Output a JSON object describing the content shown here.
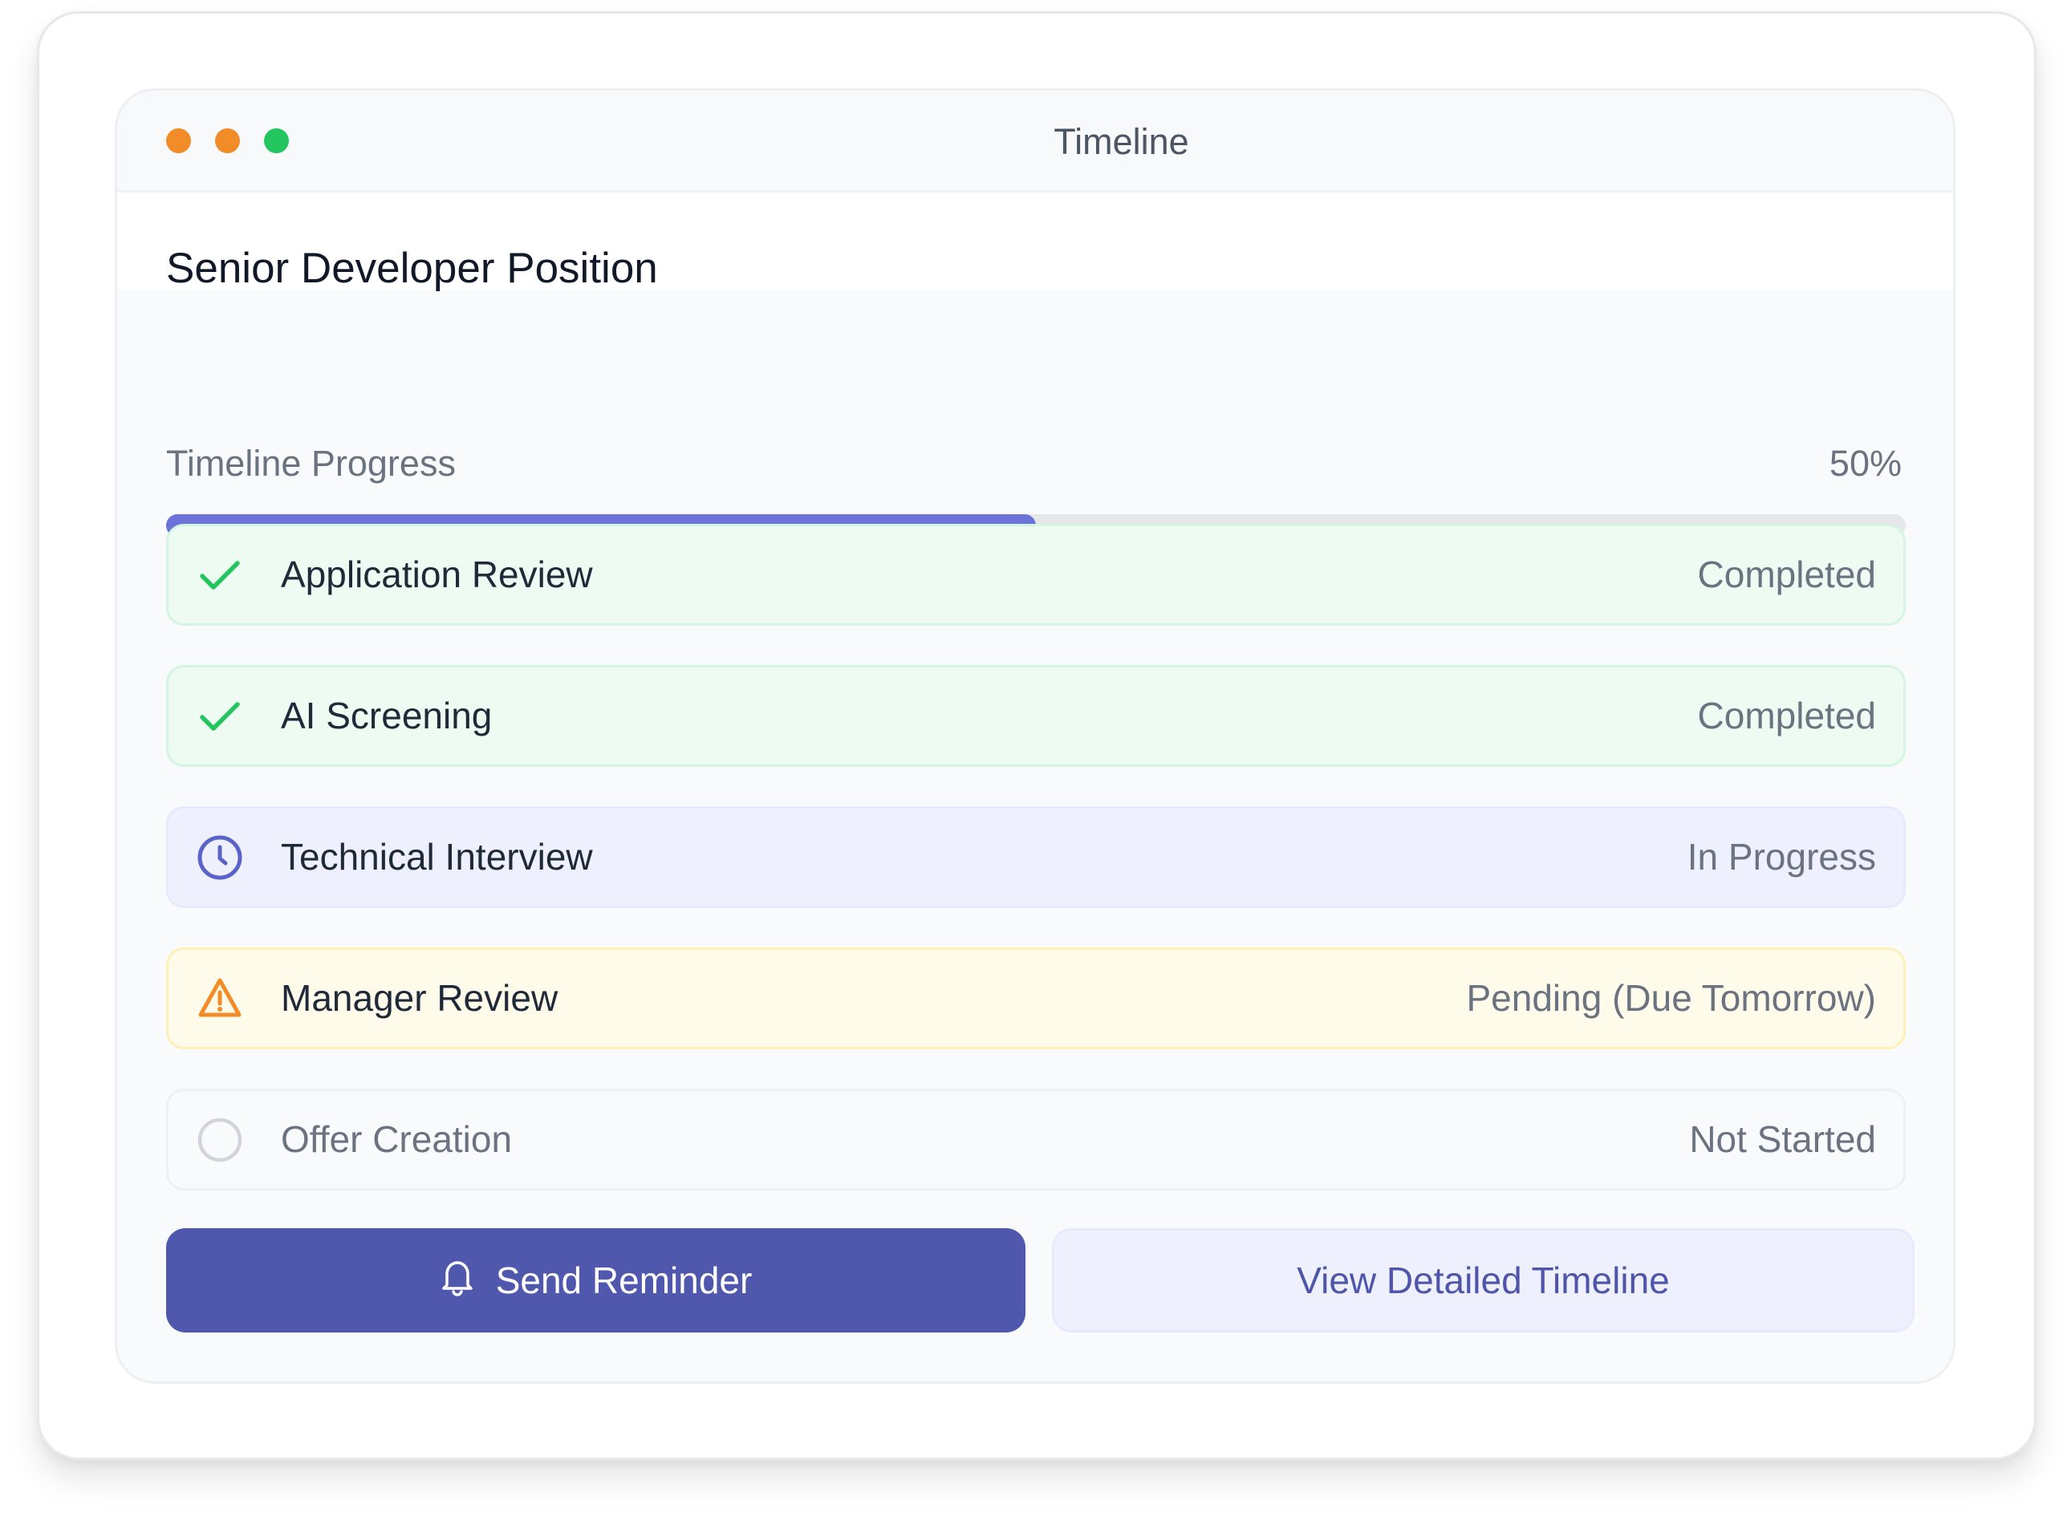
{
  "window": {
    "title": "Timeline"
  },
  "position": {
    "title": "Senior Developer Position"
  },
  "progress": {
    "label": "Timeline Progress",
    "percent_label": "50%",
    "value": 0.5
  },
  "steps": [
    {
      "name": "Application Review",
      "status": "Completed",
      "state": "done",
      "icon": "check-icon"
    },
    {
      "name": "AI Screening",
      "status": "Completed",
      "state": "done",
      "icon": "check-icon"
    },
    {
      "name": "Technical Interview",
      "status": "In Progress",
      "state": "progress",
      "icon": "clock-icon"
    },
    {
      "name": "Manager Review",
      "status": "Pending (Due Tomorrow)",
      "state": "pending",
      "icon": "warning-icon"
    },
    {
      "name": "Offer Creation",
      "status": "Not Started",
      "state": "todo",
      "icon": "empty-circle-icon"
    }
  ],
  "actions": {
    "send_reminder": "Send Reminder",
    "view_timeline": "View Detailed Timeline"
  },
  "colors": {
    "accent": "#5058ad",
    "progress_fill": "#6b72d8",
    "success": "#22c55e",
    "warning": "#f28c28"
  }
}
